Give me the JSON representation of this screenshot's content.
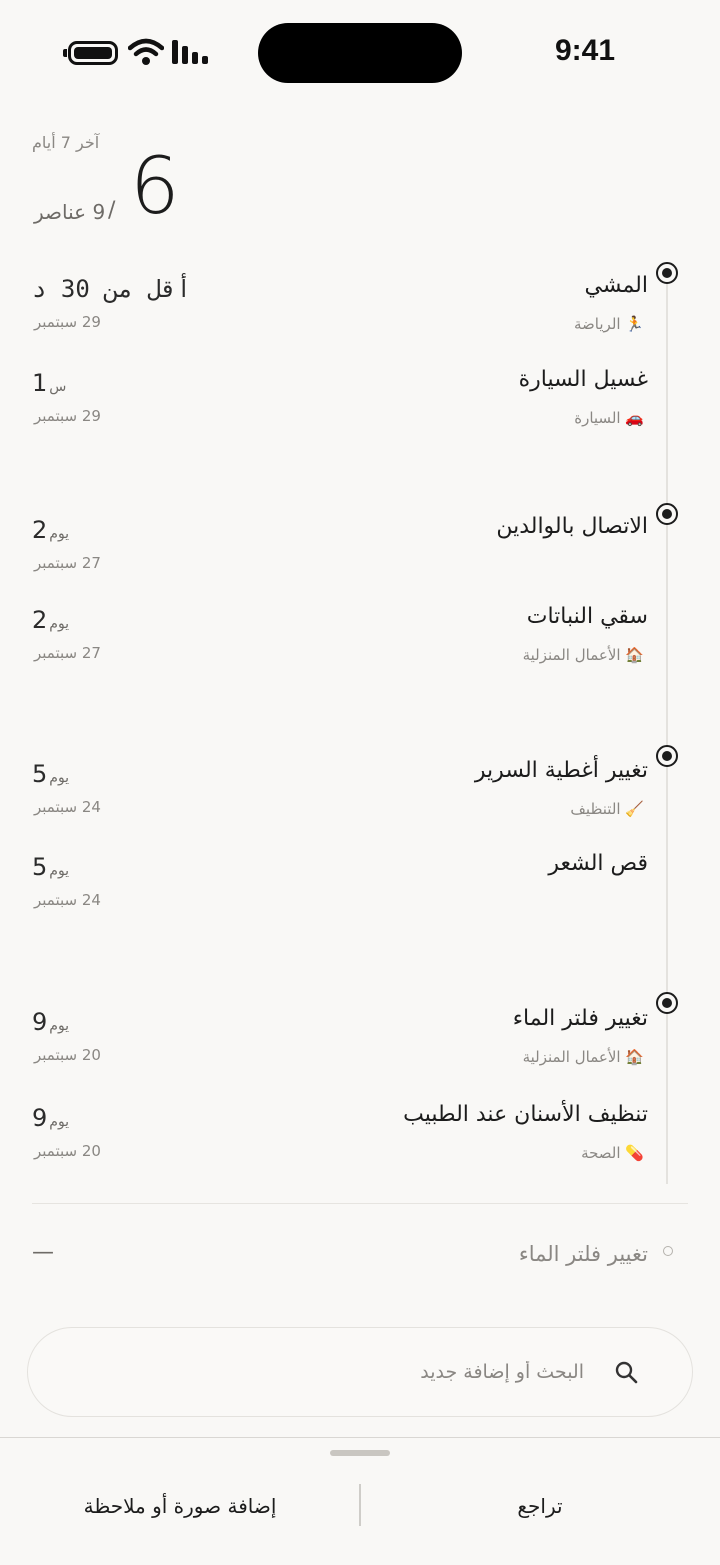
{
  "status_bar": {
    "time": "9:41"
  },
  "summary": {
    "range_label": "آخر 7 أيام",
    "done_count": "6",
    "separator": "/",
    "total_label": "9 عناصر"
  },
  "groups": [
    {
      "items": [
        {
          "title": "المشي",
          "category": "🏃 الرياضة",
          "ago_value": "أقل من 30 د",
          "ago_unit": "",
          "date": "29 سبتمبر",
          "mono": true
        },
        {
          "title": "غسيل السيارة",
          "category": "🚗 السيارة",
          "ago_value": "1",
          "ago_unit": "س",
          "date": "29 سبتمبر"
        }
      ]
    },
    {
      "items": [
        {
          "title": "الاتصال بالوالدين",
          "category": "",
          "ago_value": "2",
          "ago_unit": "يوم",
          "date": "27 سبتمبر"
        },
        {
          "title": "سقي النباتات",
          "category": "🏠 الأعمال المنزلية",
          "ago_value": "2",
          "ago_unit": "يوم",
          "date": "27 سبتمبر"
        }
      ]
    },
    {
      "items": [
        {
          "title": "تغيير أغطية السرير",
          "category": "🧹 التنظيف",
          "ago_value": "5",
          "ago_unit": "يوم",
          "date": "24 سبتمبر"
        },
        {
          "title": "قص الشعر",
          "category": "",
          "ago_value": "5",
          "ago_unit": "يوم",
          "date": "24 سبتمبر"
        }
      ]
    },
    {
      "items": [
        {
          "title": "تغيير فلتر الماء",
          "category": "🏠 الأعمال المنزلية",
          "ago_value": "9",
          "ago_unit": "يوم",
          "date": "20 سبتمبر"
        },
        {
          "title": "تنظيف الأسنان عند الطبيب",
          "category": "💊 الصحة",
          "ago_value": "9",
          "ago_unit": "يوم",
          "date": "20 سبتمبر"
        }
      ]
    }
  ],
  "pending": {
    "title": "تغيير فلتر الماء",
    "value": "—"
  },
  "search": {
    "placeholder": "البحث أو إضافة جديد"
  },
  "sheet": {
    "undo_label": "تراجع",
    "attach_label": "إضافة صورة أو ملاحظة"
  },
  "colors": {
    "background": "#f9f8f6",
    "text": "#1c1c1c",
    "muted": "#8a8783"
  }
}
